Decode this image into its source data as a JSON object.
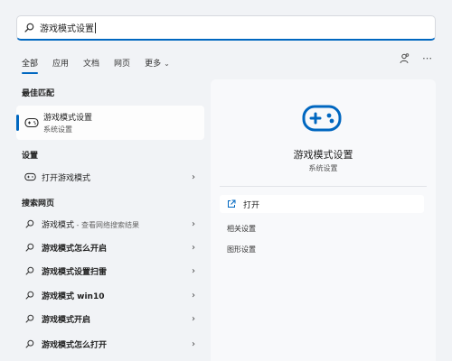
{
  "search": {
    "query": "游戏模式设置"
  },
  "tabs": [
    {
      "label": "全部"
    },
    {
      "label": "应用"
    },
    {
      "label": "文档"
    },
    {
      "label": "网页"
    },
    {
      "label": "更多"
    }
  ],
  "sections": {
    "best_match": "最佳匹配",
    "settings": "设置",
    "web": "搜索网页"
  },
  "best_match": {
    "title": "游戏模式设置",
    "subtitle": "系统设置",
    "icon": "gamepad-icon"
  },
  "settings_items": [
    {
      "label": "打开游戏模式",
      "icon": "gamepad-icon"
    }
  ],
  "web_items": [
    {
      "label": "游戏模式",
      "suffix": " - 查看网络搜索结果"
    },
    {
      "label": "游戏模式怎么开启",
      "suffix": ""
    },
    {
      "label": "游戏模式设置扫雷",
      "suffix": ""
    },
    {
      "label": "游戏模式 win10",
      "suffix": ""
    },
    {
      "label": "游戏模式开启",
      "suffix": ""
    },
    {
      "label": "游戏模式怎么打开",
      "suffix": ""
    }
  ],
  "detail": {
    "title": "游戏模式设置",
    "subtitle": "系统设置",
    "open_label": "打开",
    "related_label": "相关设置",
    "graphics_label": "图形设置"
  },
  "colors": {
    "accent": "#0067c0"
  }
}
